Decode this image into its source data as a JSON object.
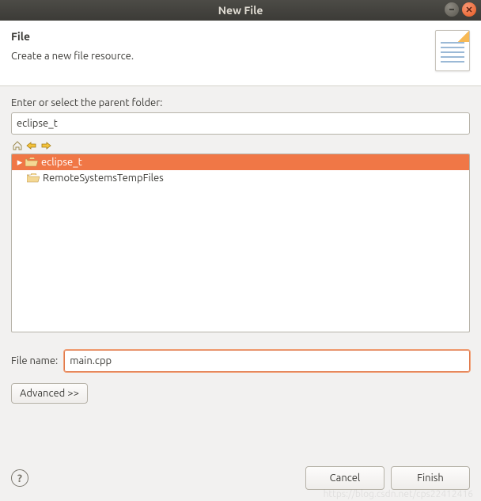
{
  "window": {
    "title": "New File"
  },
  "header": {
    "title": "File",
    "subtitle": "Create a new file resource."
  },
  "parent_folder": {
    "label": "Enter or select the parent folder:",
    "value": "eclipse_t"
  },
  "tree": {
    "items": [
      {
        "label": "eclipse_t",
        "selected": true,
        "expandable": true
      },
      {
        "label": "RemoteSystemsTempFiles",
        "selected": false,
        "expandable": false
      }
    ]
  },
  "file_name": {
    "label": "File name:",
    "value": "main.cpp"
  },
  "buttons": {
    "advanced": "Advanced >>",
    "cancel": "Cancel",
    "finish": "Finish"
  },
  "watermark": "https://blog.csdn.net/cps22412416"
}
